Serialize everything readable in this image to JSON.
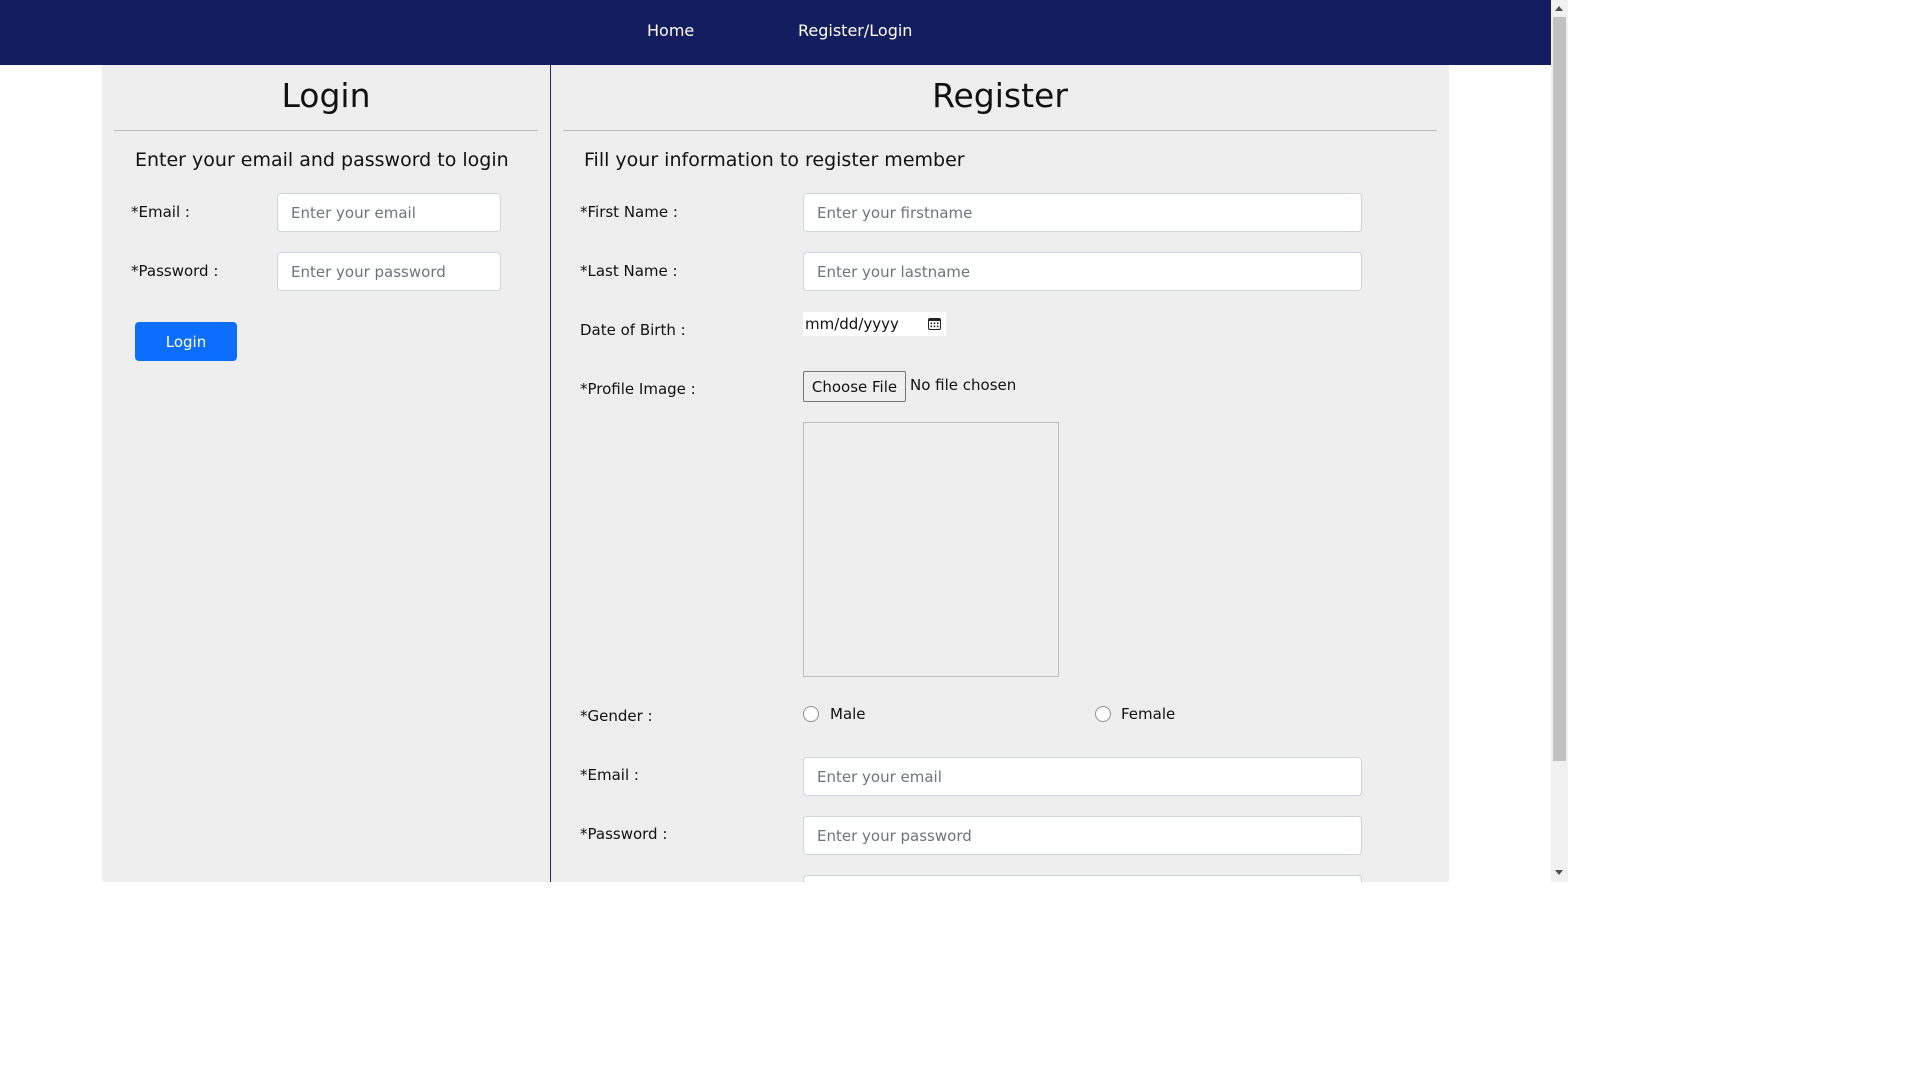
{
  "nav": {
    "home": "Home",
    "register_login": "Register/Login"
  },
  "login": {
    "title": "Login",
    "subtitle": "Enter your email and password to login",
    "email_label": "*Email :",
    "email_placeholder": "Enter your email",
    "password_label": "*Password :",
    "password_placeholder": "Enter your password",
    "button": "Login"
  },
  "register": {
    "title": "Register",
    "subtitle": "Fill your information to register member",
    "firstname_label": "*First Name :",
    "firstname_placeholder": "Enter your firstname",
    "lastname_label": "*Last Name :",
    "lastname_placeholder": "Enter your lastname",
    "dob_label": "Date of Birth :",
    "dob_value": "mm/dd/yyyy",
    "profile_label": "*Profile Image :",
    "file_button": "Choose File",
    "file_status": "No file chosen",
    "gender_label": "*Gender :",
    "gender_options": [
      "Male",
      "Female"
    ],
    "email_label": "*Email :",
    "email_placeholder": "Enter your email",
    "password_label": "*Password :",
    "password_placeholder": "Enter your password"
  },
  "colors": {
    "navbar": "#141d5e",
    "panel": "#eeeeee",
    "primary_button": "#0d6efd"
  },
  "icons": {
    "date_picker": "calendar-icon"
  }
}
